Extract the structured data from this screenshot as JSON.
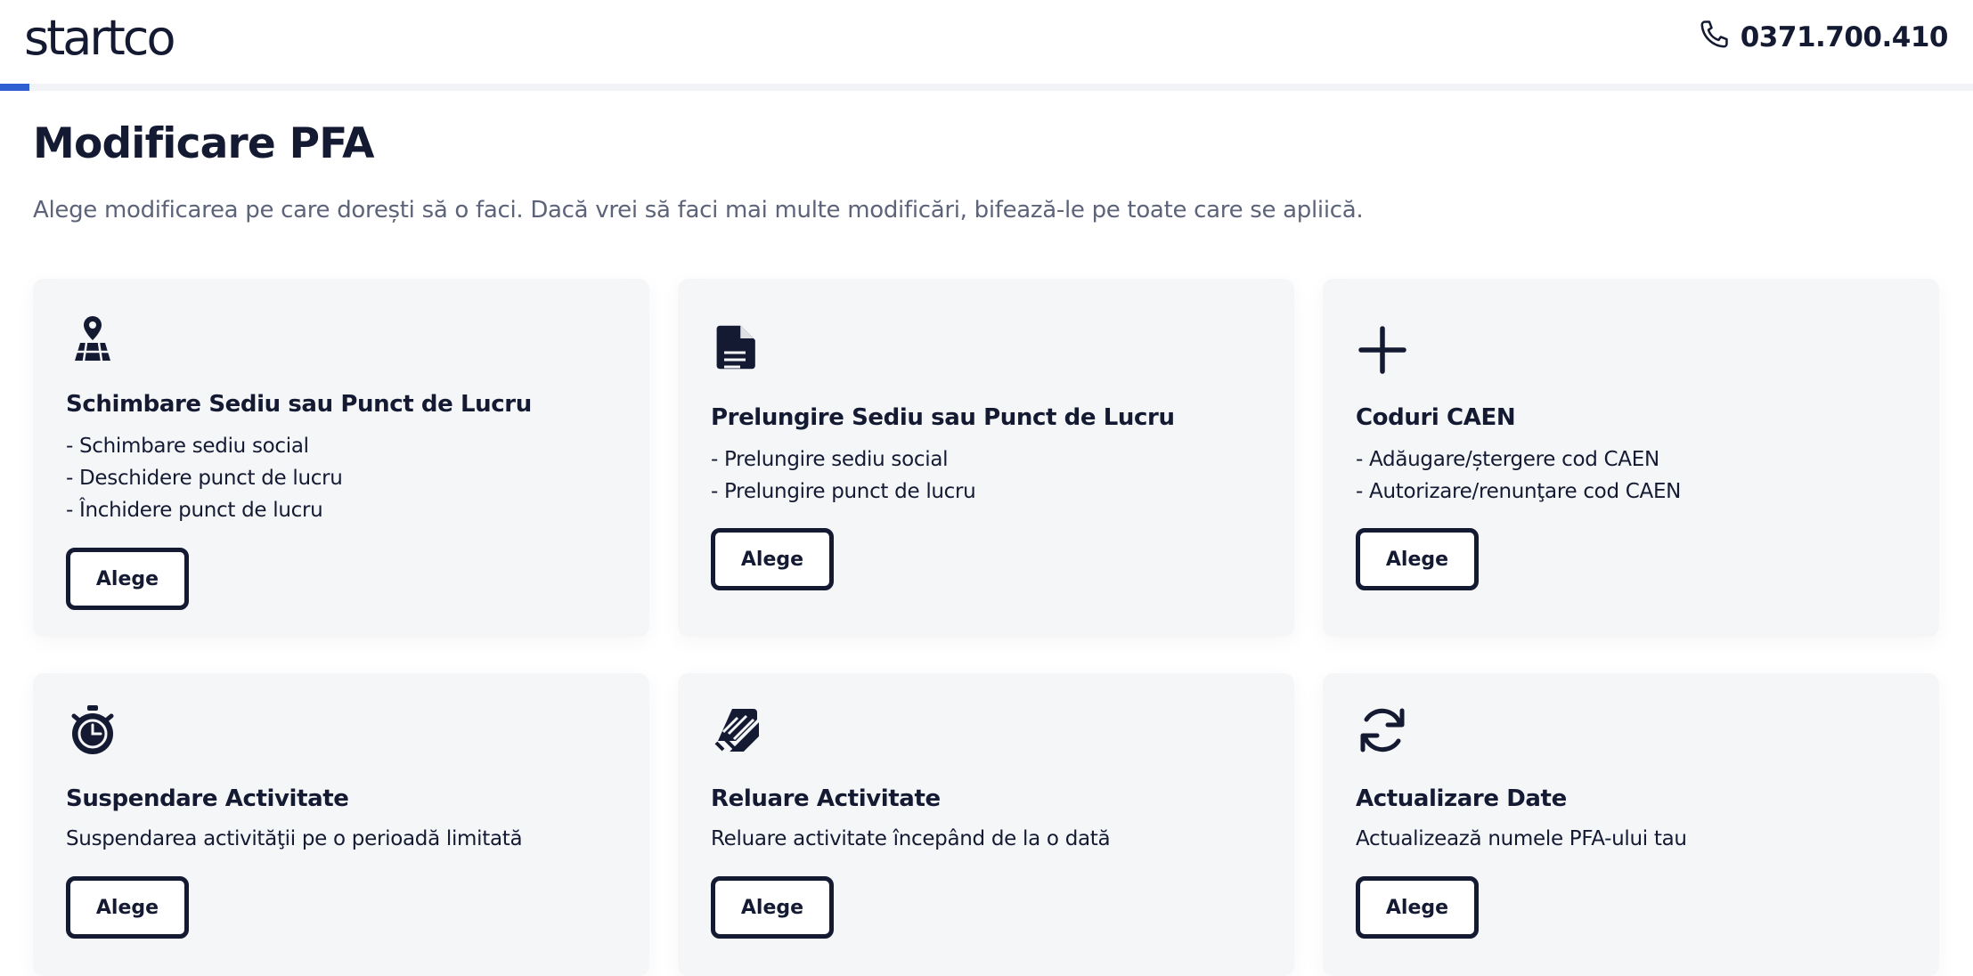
{
  "header": {
    "logo_text": "startco",
    "phone_number": "0371.700.410",
    "progress_percent": 1.5
  },
  "page": {
    "title": "Modificare PFA",
    "subtitle": "Alege modificarea pe care dorești să o faci. Dacă vrei să faci mai multe modificări, bifează-le pe toate care se apliică."
  },
  "cards": [
    {
      "icon": "map-pin-icon",
      "title": "Schimbare Sediu sau Punct de Lucru",
      "items": [
        "- Schimbare sediu social",
        "- Deschidere punct de lucru",
        "- Închidere punct de lucru"
      ],
      "button_label": "Alege"
    },
    {
      "icon": "document-icon",
      "title": "Prelungire Sediu sau Punct de Lucru",
      "items": [
        "- Prelungire sediu social",
        "- Prelungire punct de lucru"
      ],
      "button_label": "Alege"
    },
    {
      "icon": "plus-icon",
      "title": "Coduri CAEN",
      "items": [
        "- Adăugare/ștergere cod CAEN",
        "- Autorizare/renunţare cod CAEN"
      ],
      "button_label": "Alege"
    },
    {
      "icon": "stopwatch-icon",
      "title": "Suspendare Activitate",
      "description": "Suspendarea activităţii pe o perioadă limitată",
      "button_label": "Alege"
    },
    {
      "icon": "resume-icon",
      "title": "Reluare Activitate",
      "description": "Reluare activitate începând de la o dată",
      "button_label": "Alege"
    },
    {
      "icon": "refresh-icon",
      "title": "Actualizare Date",
      "description": "Actualizează numele PFA-ului tau",
      "button_label": "Alege"
    }
  ],
  "colors": {
    "text": "#151a33",
    "muted": "#5d6479",
    "card_bg": "#f4f6f8",
    "accent": "#2f5fd0"
  }
}
